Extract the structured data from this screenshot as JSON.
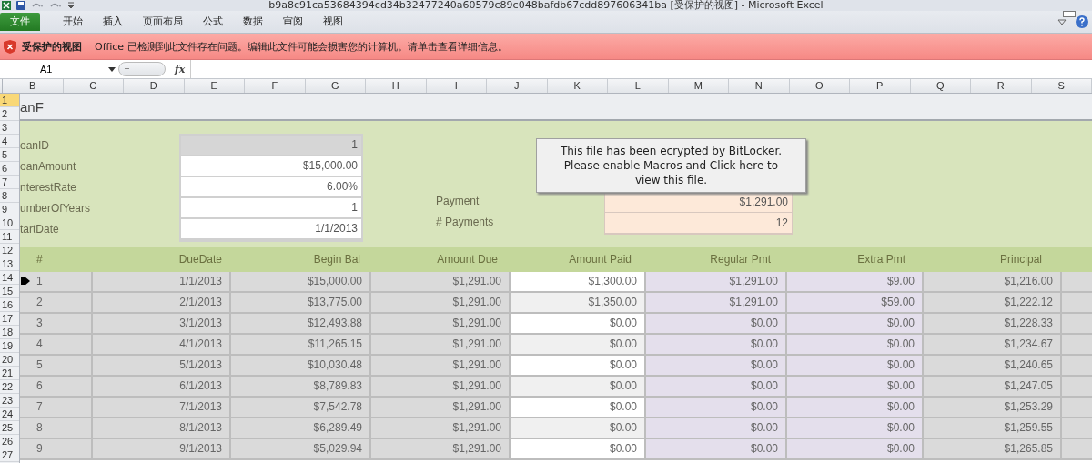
{
  "window": {
    "title": "b9a8c91ca53684394cd34b32477240a60579c89c048bafdb67cdd897606341ba  [受保护的视图]  -  Microsoft Excel"
  },
  "ribbon_tabs": [
    {
      "label": "文件",
      "kind": "file"
    },
    {
      "label": "开始",
      "kind": "tab"
    },
    {
      "label": "插入",
      "kind": "tab"
    },
    {
      "label": "页面布局",
      "kind": "tab"
    },
    {
      "label": "公式",
      "kind": "tab"
    },
    {
      "label": "数据",
      "kind": "tab"
    },
    {
      "label": "审阅",
      "kind": "tab"
    },
    {
      "label": "视图",
      "kind": "tab"
    }
  ],
  "protected_view_bar": {
    "title": "受保护的视图",
    "message": "Office 已检测到此文件存在问题。编辑此文件可能会损害您的计算机。请单击查看详细信息。"
  },
  "formula_bar": {
    "name_box": "A1",
    "function_label": "fx"
  },
  "column_headers": [
    "B",
    "C",
    "D",
    "E",
    "F",
    "G",
    "H",
    "I",
    "J",
    "K",
    "L",
    "M",
    "N",
    "O",
    "P",
    "Q",
    "R",
    "S"
  ],
  "row_headers": [
    {
      "label": "1",
      "selected": true
    },
    {
      "label": "2",
      "selected": false
    },
    {
      "label": "3",
      "selected": false
    },
    {
      "label": "4",
      "selected": false
    },
    {
      "label": "5",
      "selected": false
    },
    {
      "label": "6",
      "selected": false
    },
    {
      "label": "7",
      "selected": false
    },
    {
      "label": "8",
      "selected": false
    },
    {
      "label": "9",
      "selected": false
    },
    {
      "label": "10",
      "selected": false
    },
    {
      "label": "11",
      "selected": false
    },
    {
      "label": "12",
      "selected": false
    },
    {
      "label": "13",
      "selected": false
    },
    {
      "label": "14",
      "selected": false
    },
    {
      "label": "15",
      "selected": false
    },
    {
      "label": "16",
      "selected": false
    },
    {
      "label": "17",
      "selected": false
    },
    {
      "label": "18",
      "selected": false
    },
    {
      "label": "19",
      "selected": false
    },
    {
      "label": "20",
      "selected": false
    },
    {
      "label": "21",
      "selected": false
    },
    {
      "label": "22",
      "selected": false
    },
    {
      "label": "23",
      "selected": false
    },
    {
      "label": "24",
      "selected": false
    },
    {
      "label": "25",
      "selected": false
    },
    {
      "label": "26",
      "selected": false
    },
    {
      "label": "27",
      "selected": false
    }
  ],
  "sheet": {
    "title": "anF",
    "inputs": [
      {
        "label": "oanID",
        "value": "1",
        "locked": true
      },
      {
        "label": "oanAmount",
        "value": "$15,000.00",
        "locked": false
      },
      {
        "label": "nterestRate",
        "value": "6.00%",
        "locked": false
      },
      {
        "label": "umberOfYears",
        "value": "1",
        "locked": false
      },
      {
        "label": "tartDate",
        "value": "1/1/2013",
        "locked": false
      }
    ],
    "outputs": [
      {
        "label": "Payment",
        "value": "$1,291.00"
      },
      {
        "label": "# Payments",
        "value": "12"
      }
    ]
  },
  "popup": {
    "text": "This file has been ecrypted by BitLocker. Please enable Macros and Click here to view this file."
  },
  "schedule": {
    "columns": [
      "#",
      "DueDate",
      "Begin Bal",
      "Amount Due",
      "Amount Paid",
      "Regular Pmt",
      "Extra Pmt",
      "Principal"
    ],
    "rows": [
      [
        "1",
        "1/1/2013",
        "$15,000.00",
        "$1,291.00",
        "$1,300.00",
        "$1,291.00",
        "$9.00",
        "$1,216.00"
      ],
      [
        "2",
        "2/1/2013",
        "$13,775.00",
        "$1,291.00",
        "$1,350.00",
        "$1,291.00",
        "$59.00",
        "$1,222.12"
      ],
      [
        "3",
        "3/1/2013",
        "$12,493.88",
        "$1,291.00",
        "$0.00",
        "$0.00",
        "$0.00",
        "$1,228.33"
      ],
      [
        "4",
        "4/1/2013",
        "$11,265.15",
        "$1,291.00",
        "$0.00",
        "$0.00",
        "$0.00",
        "$1,234.67"
      ],
      [
        "5",
        "5/1/2013",
        "$10,030.48",
        "$1,291.00",
        "$0.00",
        "$0.00",
        "$0.00",
        "$1,240.65"
      ],
      [
        "6",
        "6/1/2013",
        "$8,789.83",
        "$1,291.00",
        "$0.00",
        "$0.00",
        "$0.00",
        "$1,247.05"
      ],
      [
        "7",
        "7/1/2013",
        "$7,542.78",
        "$1,291.00",
        "$0.00",
        "$0.00",
        "$0.00",
        "$1,253.29"
      ],
      [
        "8",
        "8/1/2013",
        "$6,289.49",
        "$1,291.00",
        "$0.00",
        "$0.00",
        "$0.00",
        "$1,259.55"
      ],
      [
        "9",
        "9/1/2013",
        "$5,029.94",
        "$1,291.00",
        "$0.00",
        "$0.00",
        "$0.00",
        "$1,265.85"
      ]
    ]
  }
}
